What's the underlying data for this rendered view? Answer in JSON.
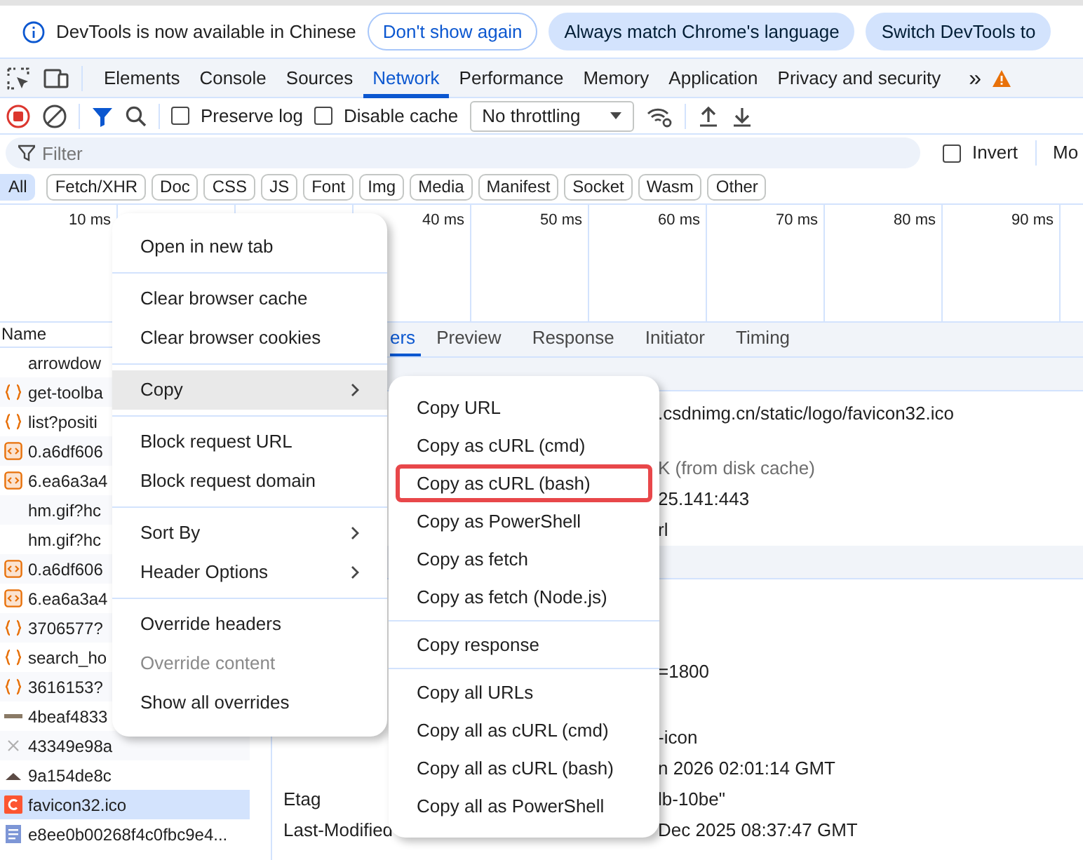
{
  "banner": {
    "message": "DevTools is now available in Chinese",
    "buttons": [
      {
        "label": "Don't show again",
        "kind": "outline"
      },
      {
        "label": "Always match Chrome's language",
        "kind": "tonal"
      },
      {
        "label": "Switch DevTools to",
        "kind": "tonal"
      }
    ]
  },
  "panel_tabs": [
    {
      "label": "Elements",
      "selected": false
    },
    {
      "label": "Console",
      "selected": false
    },
    {
      "label": "Sources",
      "selected": false
    },
    {
      "label": "Network",
      "selected": true
    },
    {
      "label": "Performance",
      "selected": false
    },
    {
      "label": "Memory",
      "selected": false
    },
    {
      "label": "Application",
      "selected": false
    },
    {
      "label": "Privacy and security",
      "selected": false
    }
  ],
  "more_tabs": "»",
  "toolbar": {
    "recording": true,
    "filter_active": true,
    "preserve_log": {
      "label": "Preserve log",
      "checked": false
    },
    "disable_cache": {
      "label": "Disable cache",
      "checked": false
    },
    "throttling": "No throttling"
  },
  "filter": {
    "placeholder": "Filter",
    "invert": {
      "label": "Invert",
      "checked": false
    },
    "more": "Mo"
  },
  "type_filters": [
    {
      "label": "All",
      "selected": true
    },
    {
      "label": "Fetch/XHR",
      "selected": false
    },
    {
      "label": "Doc",
      "selected": false
    },
    {
      "label": "CSS",
      "selected": false
    },
    {
      "label": "JS",
      "selected": false
    },
    {
      "label": "Font",
      "selected": false
    },
    {
      "label": "Img",
      "selected": false
    },
    {
      "label": "Media",
      "selected": false
    },
    {
      "label": "Manifest",
      "selected": false
    },
    {
      "label": "Socket",
      "selected": false
    },
    {
      "label": "Wasm",
      "selected": false
    },
    {
      "label": "Other",
      "selected": false
    }
  ],
  "timeline": {
    "ticks": [
      "10 ms",
      "40 ms",
      "50 ms",
      "60 ms",
      "70 ms",
      "80 ms",
      "90 ms"
    ]
  },
  "requests": {
    "header": "Name",
    "rows": [
      {
        "name": "arrowdow",
        "kind": "image",
        "selected": false
      },
      {
        "name": "get-toolba",
        "kind": "fetch",
        "selected": false
      },
      {
        "name": "list?positi",
        "kind": "fetch",
        "selected": false
      },
      {
        "name": "0.a6df606",
        "kind": "script",
        "selected": false
      },
      {
        "name": "6.ea6a3a4",
        "kind": "script",
        "selected": false
      },
      {
        "name": "hm.gif?hc",
        "kind": "image",
        "selected": false
      },
      {
        "name": "hm.gif?hc",
        "kind": "image",
        "selected": false
      },
      {
        "name": "0.a6df606",
        "kind": "script",
        "selected": false
      },
      {
        "name": "6.ea6a3a4",
        "kind": "script",
        "selected": false
      },
      {
        "name": "3706577?",
        "kind": "fetch",
        "selected": false
      },
      {
        "name": "search_ho",
        "kind": "fetch",
        "selected": false
      },
      {
        "name": "3616153?",
        "kind": "fetch",
        "selected": false
      },
      {
        "name": "4beaf4833",
        "kind": "image-bar",
        "selected": false
      },
      {
        "name": "43349e98a",
        "kind": "image-broken",
        "selected": false
      },
      {
        "name": "9a154de8c",
        "kind": "image-thumb",
        "selected": false
      },
      {
        "name": "favicon32.ico",
        "kind": "favicon",
        "selected": true
      },
      {
        "name": "e8ee0b00268f4c0fbc9e4...",
        "kind": "document",
        "selected": false
      }
    ]
  },
  "detail_tabs": [
    {
      "label": "ers",
      "selected": true
    },
    {
      "label": "Preview",
      "selected": false
    },
    {
      "label": "Response",
      "selected": false
    },
    {
      "label": "Initiator",
      "selected": false
    },
    {
      "label": "Timing",
      "selected": false
    }
  ],
  "detail_rows": [
    {
      "kind": "section"
    },
    {
      "kind": "row",
      "value": ".csdnimg.cn/static/logo/favicon32.ico"
    },
    {
      "kind": "row",
      "value": "K (from disk cache)",
      "muted": true
    },
    {
      "kind": "row",
      "value": "25.141:443"
    },
    {
      "kind": "row",
      "value": "rl"
    },
    {
      "kind": "section"
    },
    {
      "kind": "row",
      "value": "=1800"
    },
    {
      "kind": "row",
      "value": "-icon"
    },
    {
      "kind": "row",
      "value": "n 2026 02:01:14 GMT"
    },
    {
      "kind": "row",
      "label": "Etag",
      "value": "lb-10be\""
    },
    {
      "kind": "row",
      "label": "Last-Modified",
      "value": "Dec 2025 08:37:47 GMT"
    }
  ],
  "context_menu": {
    "groups": [
      [
        {
          "label": "Open in new tab",
          "hovered": false,
          "disabled": false,
          "submenu": false
        }
      ],
      [
        {
          "label": "Clear browser cache",
          "hovered": false,
          "disabled": false,
          "submenu": false
        },
        {
          "label": "Clear browser cookies",
          "hovered": false,
          "disabled": false,
          "submenu": false
        }
      ],
      [
        {
          "label": "Copy",
          "hovered": true,
          "disabled": false,
          "submenu": true
        }
      ],
      [
        {
          "label": "Block request URL",
          "hovered": false,
          "disabled": false,
          "submenu": false
        },
        {
          "label": "Block request domain",
          "hovered": false,
          "disabled": false,
          "submenu": false
        }
      ],
      [
        {
          "label": "Sort By",
          "hovered": false,
          "disabled": false,
          "submenu": true
        },
        {
          "label": "Header Options",
          "hovered": false,
          "disabled": false,
          "submenu": true
        }
      ],
      [
        {
          "label": "Override headers",
          "hovered": false,
          "disabled": false,
          "submenu": false
        },
        {
          "label": "Override content",
          "hovered": false,
          "disabled": true,
          "submenu": false
        },
        {
          "label": "Show all overrides",
          "hovered": false,
          "disabled": false,
          "submenu": false
        }
      ]
    ]
  },
  "copy_submenu": {
    "groups": [
      [
        {
          "label": "Copy URL",
          "highlighted": false
        },
        {
          "label": "Copy as cURL (cmd)",
          "highlighted": false
        },
        {
          "label": "Copy as cURL (bash)",
          "highlighted": true
        },
        {
          "label": "Copy as PowerShell",
          "highlighted": false
        },
        {
          "label": "Copy as fetch",
          "highlighted": false
        },
        {
          "label": "Copy as fetch (Node.js)",
          "highlighted": false
        }
      ],
      [
        {
          "label": "Copy response",
          "highlighted": false
        }
      ],
      [
        {
          "label": "Copy all URLs",
          "highlighted": false
        },
        {
          "label": "Copy all as cURL (cmd)",
          "highlighted": false
        },
        {
          "label": "Copy all as cURL (bash)",
          "highlighted": false
        },
        {
          "label": "Copy all as PowerShell",
          "highlighted": false
        }
      ]
    ]
  }
}
